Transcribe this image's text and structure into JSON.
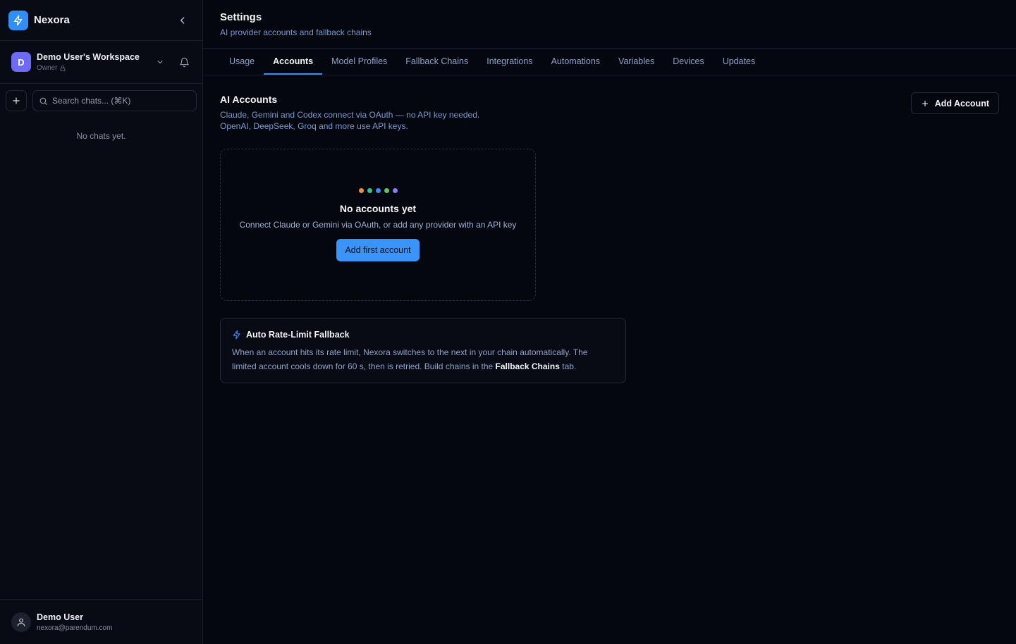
{
  "app": {
    "name": "Nexora",
    "accent": "#2f8ff7"
  },
  "sidebar": {
    "workspace": {
      "initial": "D",
      "name": "Demo User's Workspace",
      "role": "Owner"
    },
    "search": {
      "placeholder": "Search chats... (⌘K)"
    },
    "empty_text": "No chats yet.",
    "user": {
      "name": "Demo User",
      "email": "nexora@parendum.com"
    }
  },
  "header": {
    "title": "Settings",
    "subtitle": "AI provider accounts and fallback chains"
  },
  "tabs": [
    {
      "label": "Usage",
      "active": false
    },
    {
      "label": "Accounts",
      "active": true
    },
    {
      "label": "Model Profiles",
      "active": false
    },
    {
      "label": "Fallback Chains",
      "active": false
    },
    {
      "label": "Integrations",
      "active": false
    },
    {
      "label": "Automations",
      "active": false
    },
    {
      "label": "Variables",
      "active": false
    },
    {
      "label": "Devices",
      "active": false
    },
    {
      "label": "Updates",
      "active": false
    }
  ],
  "accounts": {
    "title": "AI Accounts",
    "desc_line1": "Claude, Gemini and Codex connect via OAuth — no API key needed.",
    "desc_line2": "OpenAI, DeepSeek, Groq and more use API keys.",
    "add_button": "Add Account",
    "empty": {
      "dot_colors": [
        "#f08a4b",
        "#34c38f",
        "#3b8cf5",
        "#5ec26a",
        "#8b7cf6"
      ],
      "title": "No accounts yet",
      "desc": "Connect Claude or Gemini via OAuth, or add any provider with an API key",
      "button": "Add first account"
    }
  },
  "fallback_info": {
    "title": "Auto Rate-Limit Fallback",
    "body_prefix": "When an account hits its rate limit, Nexora switches to the next in your chain automatically. The limited account cools down for 60 s, then is retried. Build chains in the ",
    "body_strong": "Fallback Chains",
    "body_suffix": " tab."
  }
}
